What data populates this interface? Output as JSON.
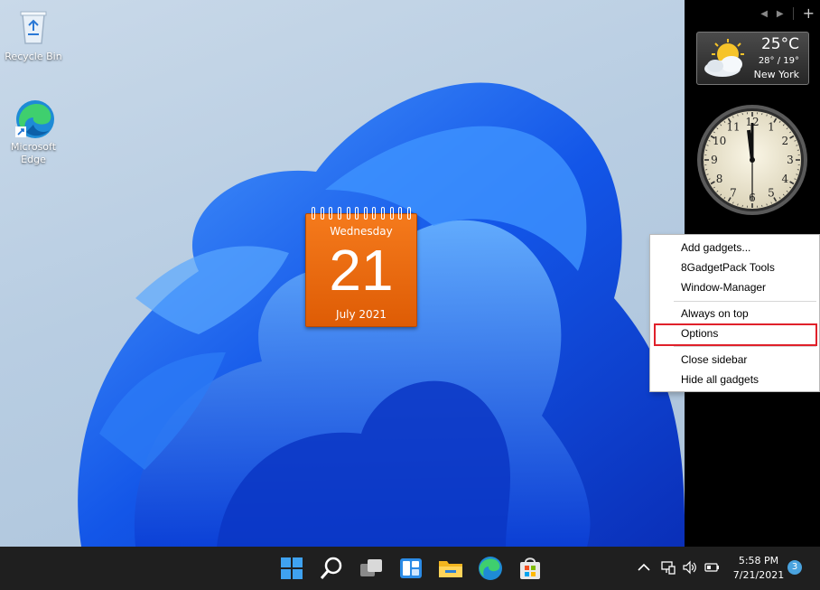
{
  "desktop": {
    "icons": [
      {
        "label": "Recycle Bin"
      },
      {
        "label": "Microsoft Edge"
      }
    ]
  },
  "calendar_gadget": {
    "day_name": "Wednesday",
    "day_number": "21",
    "month_year": "July 2021"
  },
  "sidebar": {
    "controls": {
      "prev": "◀",
      "next": "▶",
      "add": "+"
    },
    "weather": {
      "temperature": "25°C",
      "range": "28° / 19°",
      "city": "New York"
    },
    "clock": {
      "numbers": [
        "12",
        "1",
        "2",
        "3",
        "4",
        "5",
        "6",
        "7",
        "8",
        "9",
        "10",
        "11"
      ]
    }
  },
  "context_menu": {
    "items": [
      {
        "label": "Add gadgets..."
      },
      {
        "label": "8GadgetPack Tools"
      },
      {
        "label": "Window-Manager"
      },
      {
        "label": "Always on top"
      },
      {
        "label": "Options"
      },
      {
        "label": "Close sidebar"
      },
      {
        "label": "Hide all gadgets"
      }
    ],
    "highlighted": "Options"
  },
  "taskbar": {
    "apps": [
      "start-icon",
      "search-icon",
      "task-view-icon",
      "widgets-icon",
      "file-explorer-icon",
      "edge-icon",
      "store-icon"
    ],
    "tray": {
      "time": "5:58 PM",
      "date": "7/21/2021",
      "notifications": "3"
    }
  },
  "colors": {
    "calendar_orange": "#e8670d",
    "highlight_red": "#e0202a",
    "taskbar": "#1f1f1f",
    "sidebar": "#000000"
  }
}
